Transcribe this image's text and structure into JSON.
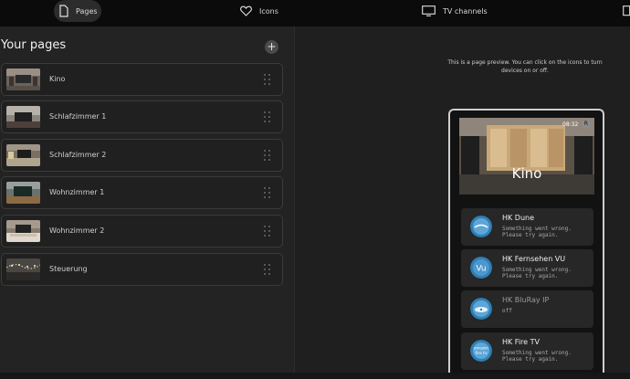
{
  "nav": {
    "pages_label": "Pages",
    "icons_label": "Icons",
    "tv_label": "TV channels"
  },
  "left": {
    "title": "Your pages",
    "add_symbol": "+",
    "pages": [
      {
        "label": "Kino"
      },
      {
        "label": "Schlafzimmer 1"
      },
      {
        "label": "Schlafzimmer 2"
      },
      {
        "label": "Wohnzimmer 1"
      },
      {
        "label": "Wohnzimmer 2"
      },
      {
        "label": "Steuerung"
      }
    ]
  },
  "preview": {
    "hint": "This is a page preview. You can click on the icons to turn devices on or off.",
    "header": {
      "title": "Kino",
      "time": "08:32",
      "badge": "R"
    },
    "devices": [
      {
        "name": "HK Dune",
        "status": "Something went wrong. Please try again."
      },
      {
        "name": "HK Fernsehen VU",
        "status": "Something went wrong. Please try again."
      },
      {
        "name": "HK BluRay IP",
        "status": "off"
      },
      {
        "name": "HK Fire TV",
        "status": "Something went wrong. Please try again."
      }
    ]
  },
  "icon_glyphs": {
    "fernsehen": "Vu",
    "firetv_top": "amazon",
    "firetv_bottom": "fire tv"
  },
  "colors": {
    "background": "#1e1f1e",
    "nav_bg": "#0b0b0b",
    "card_bg": "#262726",
    "accent_blue": "#2f7fb6"
  }
}
